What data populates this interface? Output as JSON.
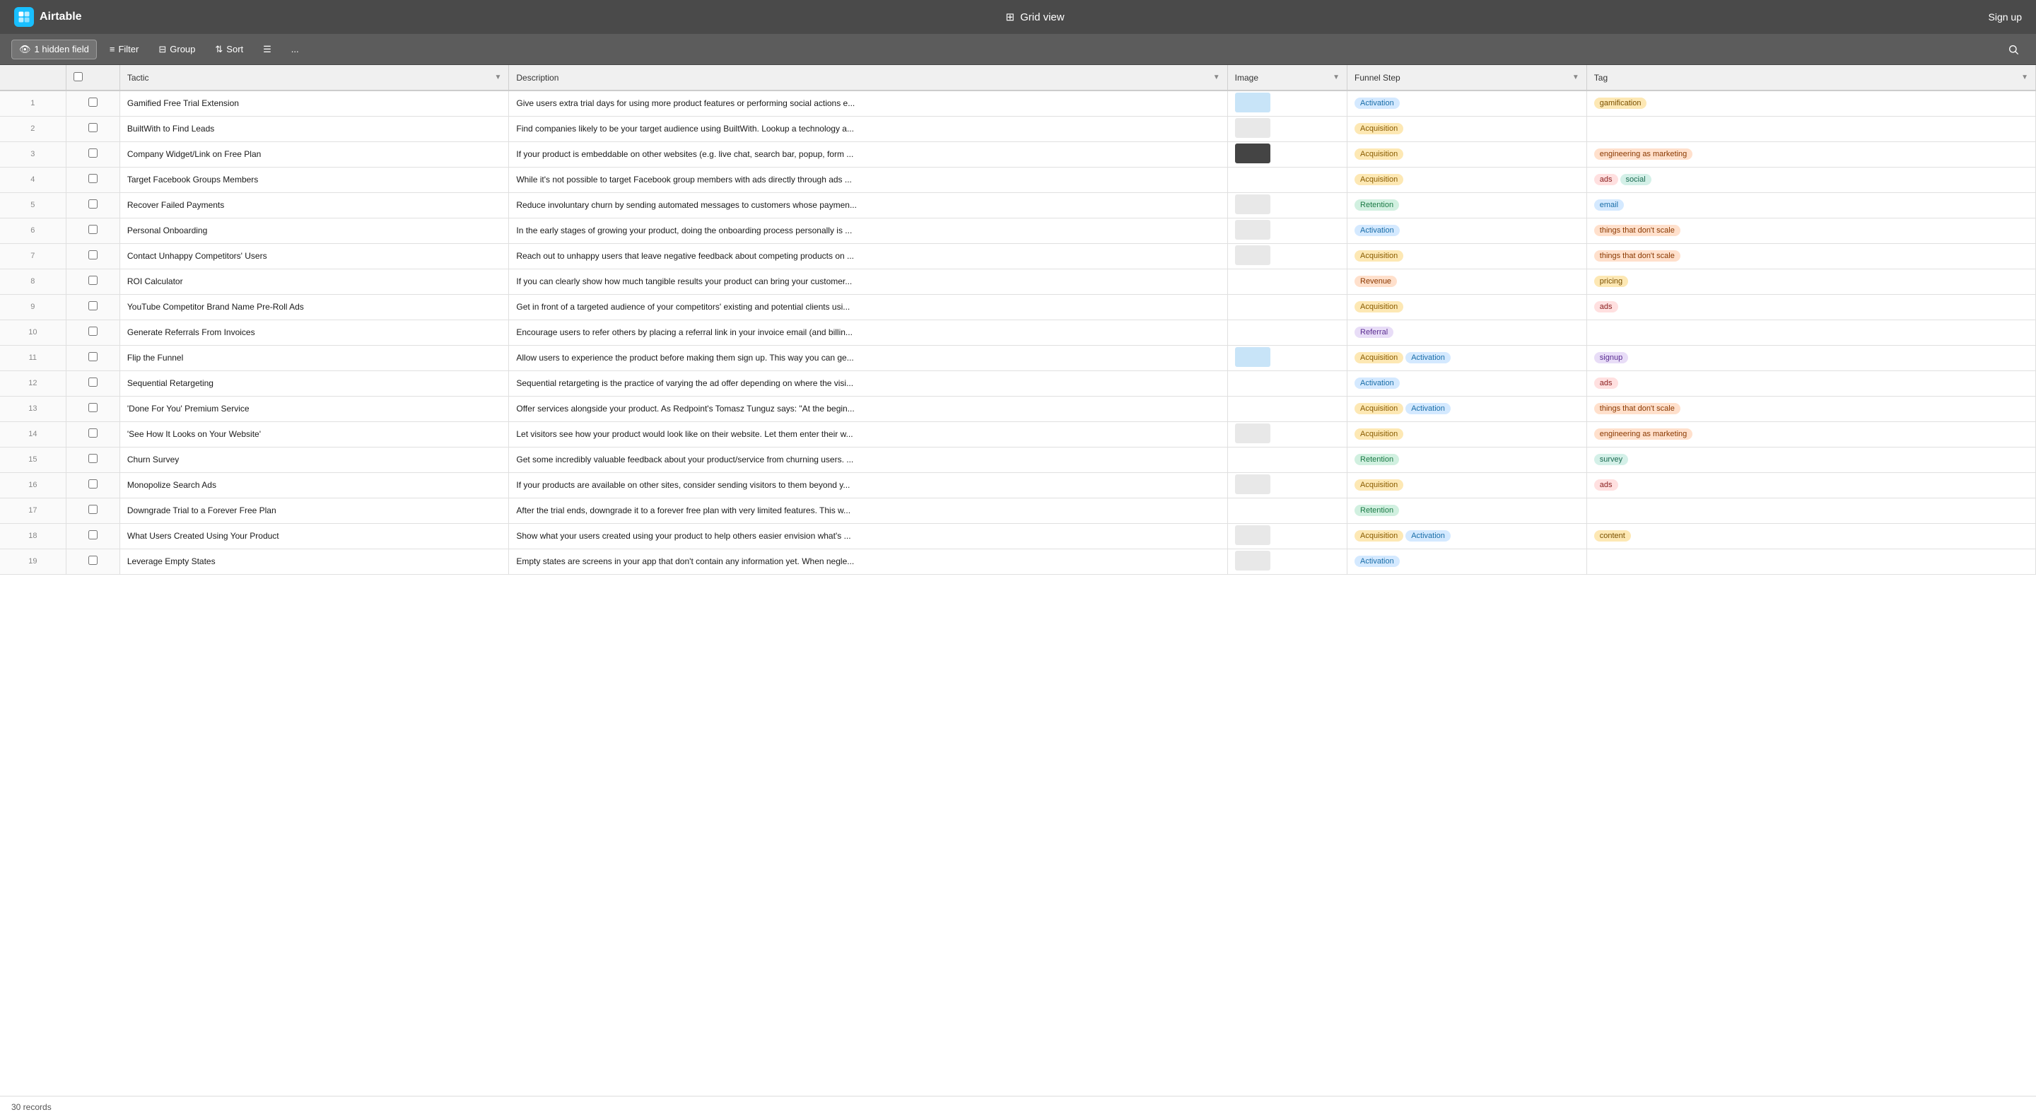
{
  "app": {
    "name": "Airtable",
    "view_title": "Grid view",
    "sign_up": "Sign up"
  },
  "toolbar": {
    "hidden_field": "1 hidden field",
    "filter": "Filter",
    "group": "Group",
    "sort": "Sort",
    "row_height": "",
    "more": "..."
  },
  "columns": [
    {
      "id": "num",
      "label": ""
    },
    {
      "id": "check",
      "label": ""
    },
    {
      "id": "tactic",
      "label": "Tactic"
    },
    {
      "id": "description",
      "label": "Description"
    },
    {
      "id": "image",
      "label": "Image"
    },
    {
      "id": "funnel_step",
      "label": "Funnel Step"
    },
    {
      "id": "tag",
      "label": "Tag"
    }
  ],
  "rows": [
    {
      "num": 1,
      "tactic": "Gamified Free Trial Extension",
      "description": "Give users extra trial days for using more product features or performing social actions e...",
      "has_image": true,
      "image_style": "blue",
      "funnel_steps": [
        "Activation"
      ],
      "tags": [
        "gamification"
      ]
    },
    {
      "num": 2,
      "tactic": "BuiltWith to Find Leads",
      "description": "Find companies likely to be your target audience using BuiltWith. Lookup a technology a...",
      "has_image": true,
      "image_style": "screenshot",
      "funnel_steps": [
        "Acquisition"
      ],
      "tags": []
    },
    {
      "num": 3,
      "tactic": "Company Widget/Link on Free Plan",
      "description": "If your product is embeddable on other websites (e.g. live chat, search bar, popup, form ...",
      "has_image": true,
      "image_style": "dark",
      "funnel_steps": [
        "Acquisition"
      ],
      "tags": [
        "engineering as marketing"
      ]
    },
    {
      "num": 4,
      "tactic": "Target Facebook Groups Members",
      "description": "While it's not possible to target Facebook group members with ads directly through ads ...",
      "has_image": false,
      "funnel_steps": [
        "Acquisition"
      ],
      "tags": [
        "ads",
        "social"
      ]
    },
    {
      "num": 5,
      "tactic": "Recover Failed Payments",
      "description": "Reduce involuntary churn by sending automated messages to customers whose paymen...",
      "has_image": true,
      "image_style": "light",
      "funnel_steps": [
        "Retention"
      ],
      "tags": [
        "email"
      ]
    },
    {
      "num": 6,
      "tactic": "Personal Onboarding",
      "description": "In the early stages of growing your product, doing the onboarding process personally is ...",
      "has_image": true,
      "image_style": "screenshot2",
      "funnel_steps": [
        "Activation"
      ],
      "tags": [
        "things that don't scale"
      ]
    },
    {
      "num": 7,
      "tactic": "Contact Unhappy Competitors' Users",
      "description": "Reach out to unhappy users that leave negative feedback about competing products on ...",
      "has_image": true,
      "image_style": "small",
      "funnel_steps": [
        "Acquisition"
      ],
      "tags": [
        "things that don't scale"
      ]
    },
    {
      "num": 8,
      "tactic": "ROI Calculator",
      "description": "If you can clearly show how much tangible results your product can bring your customer...",
      "has_image": false,
      "funnel_steps": [
        "Revenue"
      ],
      "tags": [
        "pricing"
      ]
    },
    {
      "num": 9,
      "tactic": "YouTube Competitor Brand Name Pre-Roll Ads",
      "description": "Get in front of a targeted audience of your competitors' existing and potential clients usi...",
      "has_image": false,
      "funnel_steps": [
        "Acquisition"
      ],
      "tags": [
        "ads"
      ]
    },
    {
      "num": 10,
      "tactic": "Generate Referrals From Invoices",
      "description": "Encourage users to refer others by placing a referral link in your invoice email (and billin...",
      "has_image": false,
      "funnel_steps": [
        "Referral"
      ],
      "tags": []
    },
    {
      "num": 11,
      "tactic": "Flip the Funnel",
      "description": "Allow users to experience the product before making them sign up. This way you can ge...",
      "has_image": true,
      "image_style": "blue2",
      "funnel_steps": [
        "Acquisition",
        "Activation"
      ],
      "tags": [
        "signup"
      ]
    },
    {
      "num": 12,
      "tactic": "Sequential Retargeting",
      "description": "Sequential retargeting is the practice of varying the ad offer depending on where the visi...",
      "has_image": false,
      "funnel_steps": [
        "Activation"
      ],
      "tags": [
        "ads"
      ]
    },
    {
      "num": 13,
      "tactic": "'Done For You' Premium Service",
      "description": "Offer services alongside your product. As Redpoint's Tomasz Tunguz says: \"At the begin...",
      "has_image": false,
      "funnel_steps": [
        "Acquisition",
        "Activation"
      ],
      "tags": [
        "things that don't scale"
      ]
    },
    {
      "num": 14,
      "tactic": "'See How It Looks on Your Website'",
      "description": "Let visitors see how your product would look like on their website. Let them enter their w...",
      "has_image": true,
      "image_style": "screenshot3",
      "funnel_steps": [
        "Acquisition"
      ],
      "tags": [
        "engineering as marketing"
      ]
    },
    {
      "num": 15,
      "tactic": "Churn Survey",
      "description": "Get some incredibly valuable feedback about your product/service from churning users. ...",
      "has_image": false,
      "funnel_steps": [
        "Retention"
      ],
      "tags": [
        "survey"
      ]
    },
    {
      "num": 16,
      "tactic": "Monopolize Search Ads",
      "description": "If your products are available on other sites, consider sending visitors to them beyond y...",
      "has_image": true,
      "image_style": "screenshot4",
      "funnel_steps": [
        "Acquisition"
      ],
      "tags": [
        "ads"
      ]
    },
    {
      "num": 17,
      "tactic": "Downgrade Trial to a Forever Free Plan",
      "description": "After the trial ends, downgrade it to a forever free plan with very limited features. This w...",
      "has_image": false,
      "funnel_steps": [
        "Retention"
      ],
      "tags": []
    },
    {
      "num": 18,
      "tactic": "What Users Created Using Your Product",
      "description": "Show what your users created using your product to help others easier envision what's ...",
      "has_image": true,
      "image_style": "small2",
      "funnel_steps": [
        "Acquisition",
        "Activation"
      ],
      "tags": [
        "content"
      ]
    },
    {
      "num": 19,
      "tactic": "Leverage Empty States",
      "description": "Empty states are screens in your app that don't contain any information yet. When negle...",
      "has_image": true,
      "image_style": "light2",
      "funnel_steps": [
        "Activation"
      ],
      "tags": []
    }
  ],
  "status_bar": {
    "records": "30 records"
  },
  "tag_classes": {
    "Activation": "tag-activation",
    "Acquisition": "tag-acquisition",
    "Retention": "tag-retention",
    "Revenue": "tag-revenue",
    "Referral": "tag-referral",
    "gamification": "tag-gamification",
    "ads": "tag-ads",
    "social": "tag-social",
    "email": "tag-email",
    "pricing": "tag-pricing",
    "signup": "tag-signup",
    "content": "tag-content",
    "engineering as marketing": "tag-engineering",
    "things that don't scale": "tag-things",
    "survey": "tag-survey"
  }
}
